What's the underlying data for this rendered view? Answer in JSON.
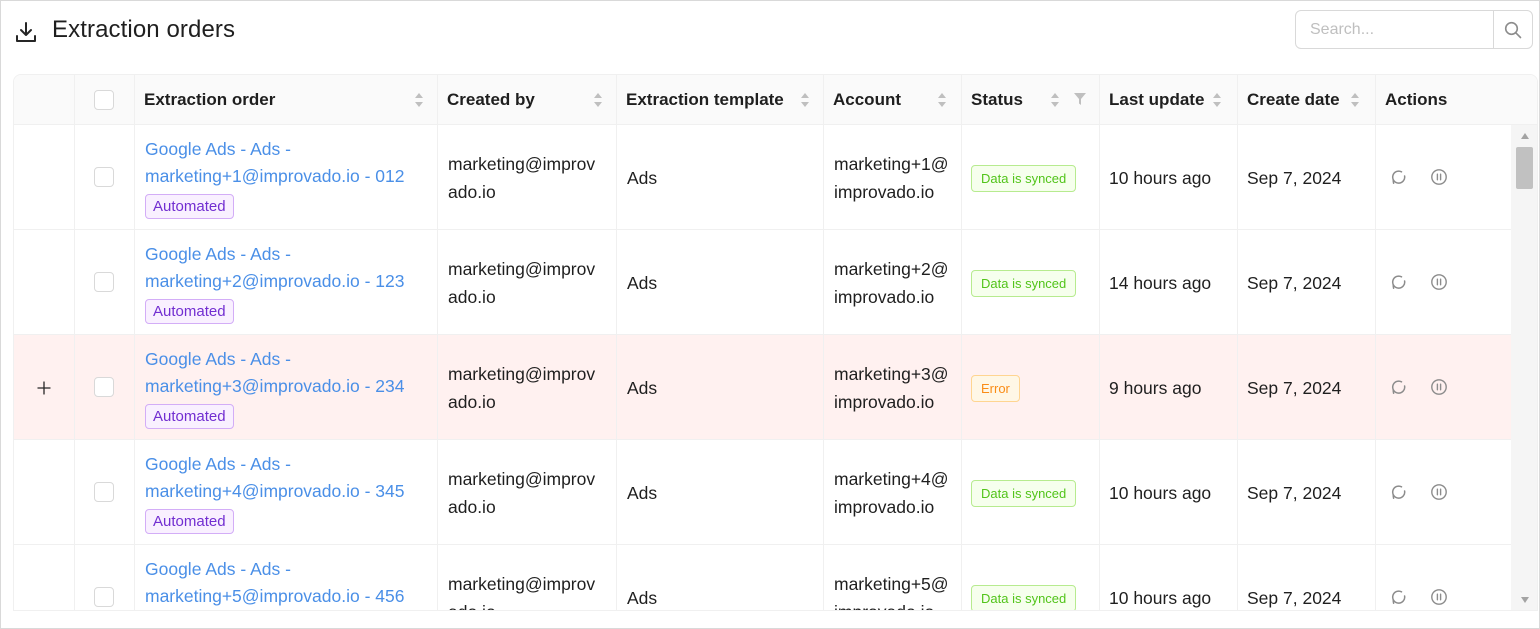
{
  "header": {
    "title": "Extraction orders",
    "icon": "download-icon",
    "search_placeholder": "Search..."
  },
  "columns": {
    "extraction_order": "Extraction order",
    "created_by": "Created by",
    "extraction_template": "Extraction template",
    "account": "Account",
    "status": "Status",
    "last_update": "Last update",
    "create_date": "Create date",
    "actions": "Actions"
  },
  "rows": [
    {
      "order_line1": "Google Ads - Ads -",
      "order_line2": "marketing+1@improvado.io - 012",
      "tag": "Automated",
      "created_line1": "marketing@improv",
      "created_line2": "ado.io",
      "template": "Ads",
      "account_line1": "marketing+1@",
      "account_line2": "improvado.io",
      "status": "Data is synced",
      "last_update": "10 hours ago",
      "create_date": "Sep 7, 2024"
    },
    {
      "order_line1": "Google Ads - Ads -",
      "order_line2": "marketing+2@improvado.io - 123",
      "tag": "Automated",
      "created_line1": "marketing@improv",
      "created_line2": "ado.io",
      "template": "Ads",
      "account_line1": "marketing+2@",
      "account_line2": "improvado.io",
      "status": "Data is synced",
      "last_update": "14 hours ago",
      "create_date": "Sep 7, 2024"
    },
    {
      "order_line1": "Google Ads - Ads -",
      "order_line2": "marketing+3@improvado.io - 234",
      "tag": "Automated",
      "created_line1": "marketing@improv",
      "created_line2": "ado.io",
      "template": "Ads",
      "account_line1": "marketing+3@",
      "account_line2": "improvado.io",
      "status": "Error",
      "last_update": "9 hours ago",
      "create_date": "Sep 7, 2024"
    },
    {
      "order_line1": "Google Ads - Ads -",
      "order_line2": "marketing+4@improvado.io - 345",
      "tag": "Automated",
      "created_line1": "marketing@improv",
      "created_line2": "ado.io",
      "template": "Ads",
      "account_line1": "marketing+4@",
      "account_line2": "improvado.io",
      "status": "Data is synced",
      "last_update": "10 hours ago",
      "create_date": "Sep 7, 2024"
    },
    {
      "order_line1": "Google Ads - Ads -",
      "order_line2": "marketing+5@improvado.io - 456",
      "tag": "",
      "created_line1": "marketing@improv",
      "created_line2": "ado.io",
      "template": "Ads",
      "account_line1": "marketing+5@",
      "account_line2": "improvado.io",
      "status": "Data is synced",
      "last_update": "10 hours ago",
      "create_date": "Sep 7, 2024"
    }
  ],
  "icons": {
    "refresh": "refresh-icon",
    "pause": "pause-icon",
    "expand": "plus-icon",
    "search": "search-icon",
    "filter": "filter-icon",
    "sort": "sort-icon"
  },
  "colors": {
    "link": "#4a8fe7",
    "error_row_bg": "#fff1f0",
    "synced_text": "#52c41a",
    "error_text": "#fa8c16",
    "tag_text": "#722ed1"
  }
}
